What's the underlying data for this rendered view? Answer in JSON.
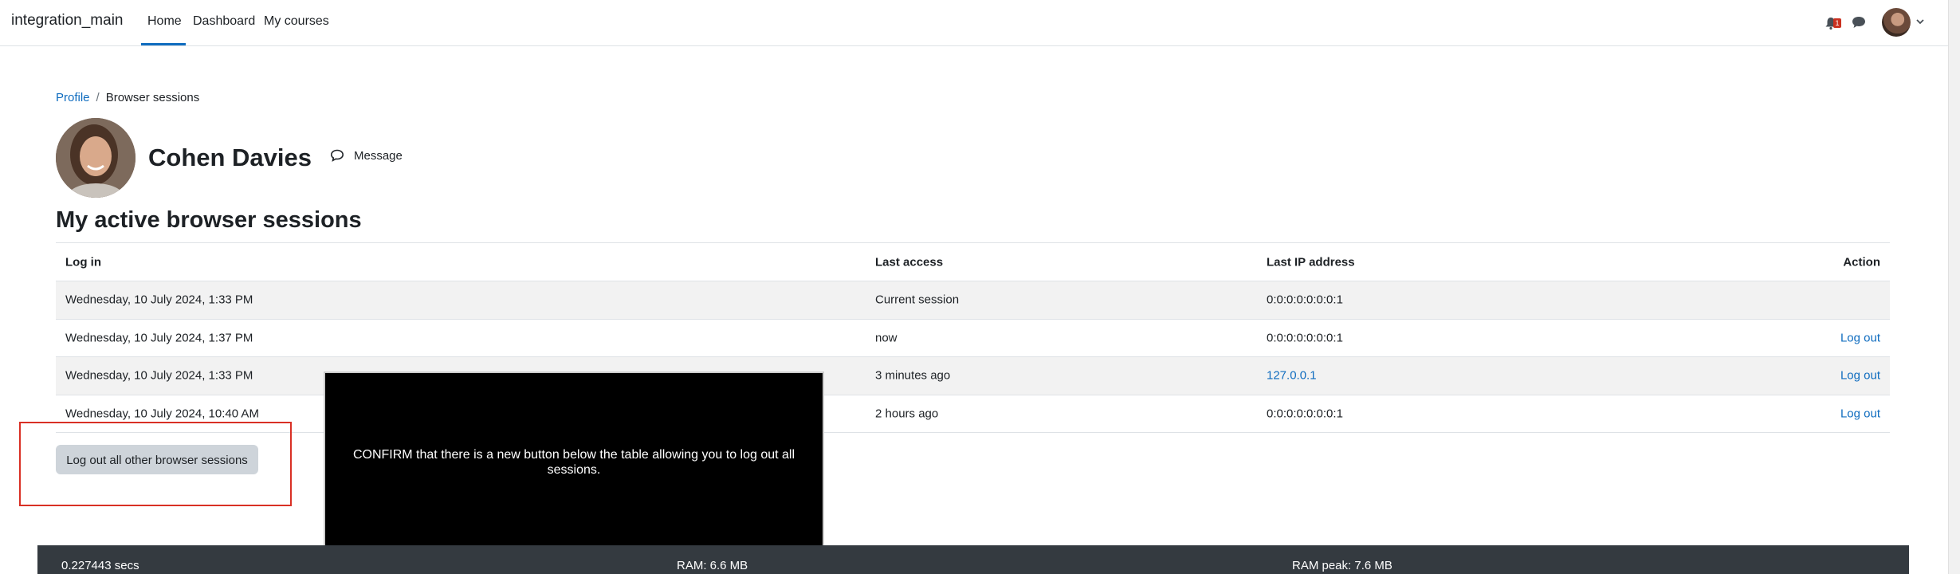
{
  "navbar": {
    "brand": "integration_main",
    "links": [
      "Home",
      "Dashboard",
      "My courses"
    ],
    "notification_count": "1"
  },
  "breadcrumb": {
    "items": [
      "Profile",
      "Browser sessions"
    ]
  },
  "profile": {
    "name": "Cohen Davies",
    "message_label": "Message"
  },
  "page_title": "My active browser sessions",
  "table": {
    "headers": [
      "Log in",
      "Last access",
      "Last IP address",
      "Action"
    ],
    "rows": [
      {
        "login": "Wednesday, 10 July 2024, 1:33 PM",
        "last_access": "Current session",
        "ip": "0:0:0:0:0:0:0:1",
        "action": ""
      },
      {
        "login": "Wednesday, 10 July 2024, 1:37 PM",
        "last_access": "now",
        "ip": "0:0:0:0:0:0:0:1",
        "action": "Log out"
      },
      {
        "login": "Wednesday, 10 July 2024, 1:33 PM",
        "last_access": "3 minutes ago",
        "ip": "127.0.0.1",
        "action": "Log out"
      },
      {
        "login": "Wednesday, 10 July 2024, 10:40 AM",
        "last_access": "2 hours ago",
        "ip": "0:0:0:0:0:0:0:1",
        "action": "Log out"
      }
    ]
  },
  "logout_all_label": "Log out all other browser sessions",
  "overlay_text": "CONFIRM that there is a new button below the table allowing you to log out all sessions.",
  "footer": {
    "time": "0.227443 secs",
    "ram": "RAM: 6.6 MB",
    "ram_peak": "RAM peak: 7.6 MB"
  },
  "colors": {
    "link": "#0f6cbf",
    "footer_bg": "#343a40",
    "highlight": "#d93025",
    "badge": "#ca3120"
  },
  "icons": [
    "bell-icon",
    "chat-icon",
    "chevron-down-icon",
    "message-icon"
  ]
}
